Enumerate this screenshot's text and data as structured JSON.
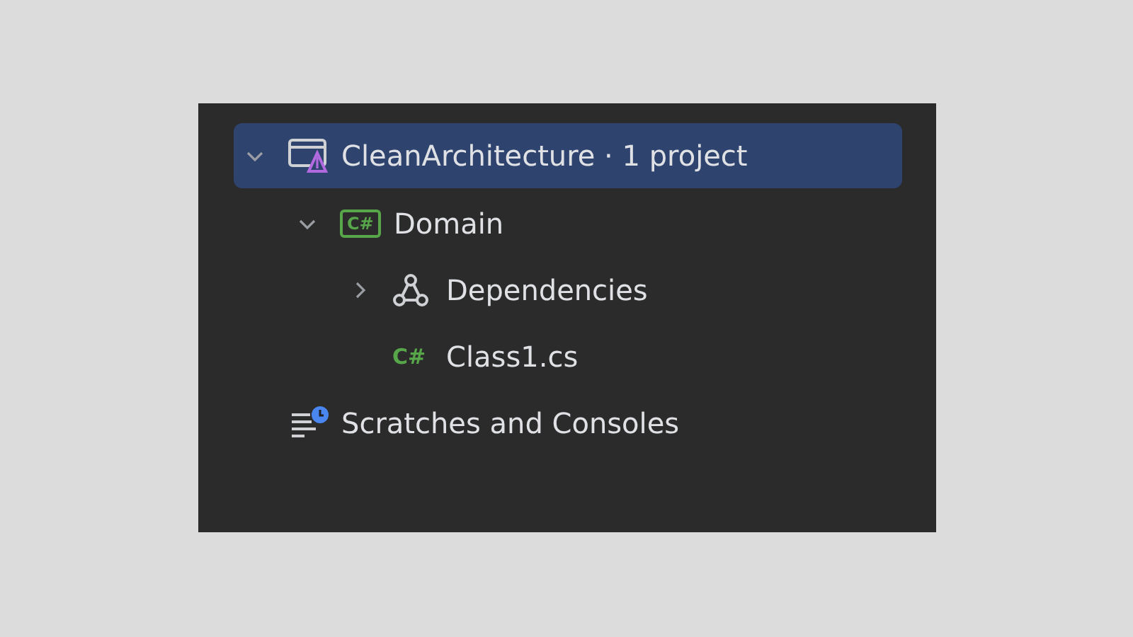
{
  "tree": [
    {
      "label": "CleanArchitecture · 1 project",
      "kind": "solution",
      "expanded": true,
      "selected": true,
      "children": [
        {
          "label": "Domain",
          "kind": "project",
          "badge": "C#",
          "expanded": true,
          "selected": false,
          "children": [
            {
              "label": "Dependencies",
              "kind": "dependencies",
              "expanded": false,
              "selected": false
            },
            {
              "label": "Class1.cs",
              "kind": "file",
              "badge": "C#",
              "selected": false
            }
          ]
        }
      ]
    },
    {
      "label": "Scratches and Consoles",
      "kind": "scratches",
      "selected": false
    }
  ]
}
